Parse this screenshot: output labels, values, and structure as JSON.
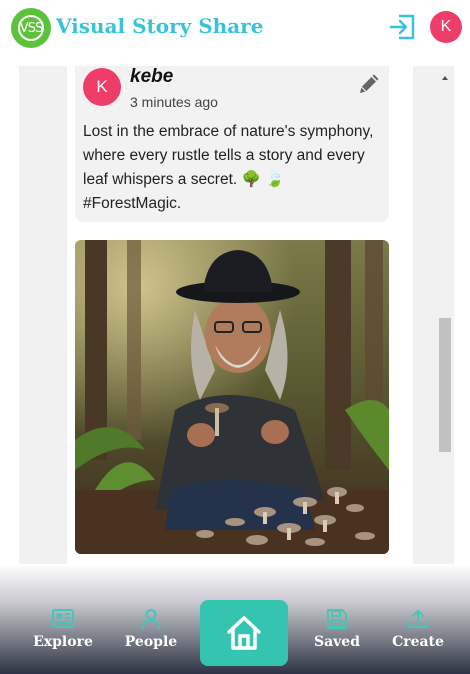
{
  "header": {
    "logo_text": "VSS",
    "title": "Visual Story Share",
    "user_initial": "K"
  },
  "post": {
    "author_initial": "K",
    "author": "kebe",
    "time": "3 minutes ago",
    "caption": "Lost in the embrace of nature's symphony, where every rustle tells a story and every leaf whispers a secret. 🌳 🍃 #ForestMagic.",
    "image_icon": "photo-man-foraging-mushrooms-forest"
  },
  "nav": {
    "explore": "Explore",
    "people": "People",
    "saved": "Saved",
    "create": "Create"
  },
  "colors": {
    "brand": "#38c3d7",
    "avatar": "#ef3d6a",
    "home": "#35c4b0",
    "logo": "#5cc23a"
  }
}
